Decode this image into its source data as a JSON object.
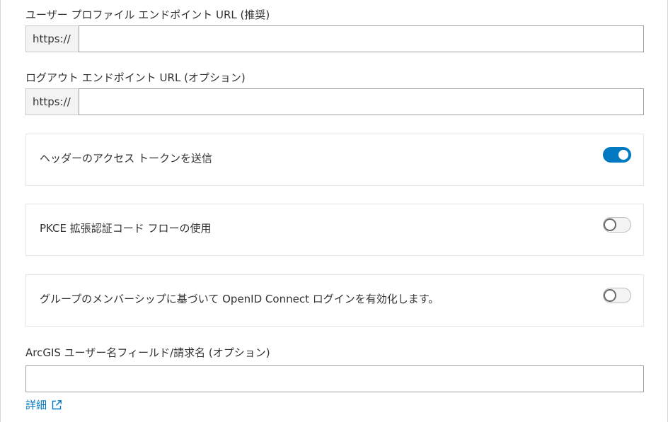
{
  "fields": {
    "user_profile_url": {
      "label": "ユーザー プロファイル エンドポイント URL (推奨)",
      "prefix": "https://",
      "value": "",
      "placeholder": ""
    },
    "logout_url": {
      "label": "ログアウト エンドポイント URL (オプション)",
      "prefix": "https://",
      "value": "",
      "placeholder": ""
    },
    "username_field": {
      "label": "ArcGIS ユーザー名フィールド/請求名 (オプション)",
      "value": "",
      "placeholder": ""
    }
  },
  "toggles": [
    {
      "label": "ヘッダーのアクセス トークンを送信",
      "state": "on"
    },
    {
      "label": "PKCE 拡張認証コード フローの使用",
      "state": "off"
    },
    {
      "label": "グループのメンバーシップに基づいて OpenID Connect ログインを有効化します。",
      "state": "off"
    }
  ],
  "learn_more": {
    "label": "詳細",
    "icon": "external-link-icon"
  },
  "colors": {
    "accent": "#0079c1",
    "text": "#323232",
    "border": "#9f9f9f"
  }
}
